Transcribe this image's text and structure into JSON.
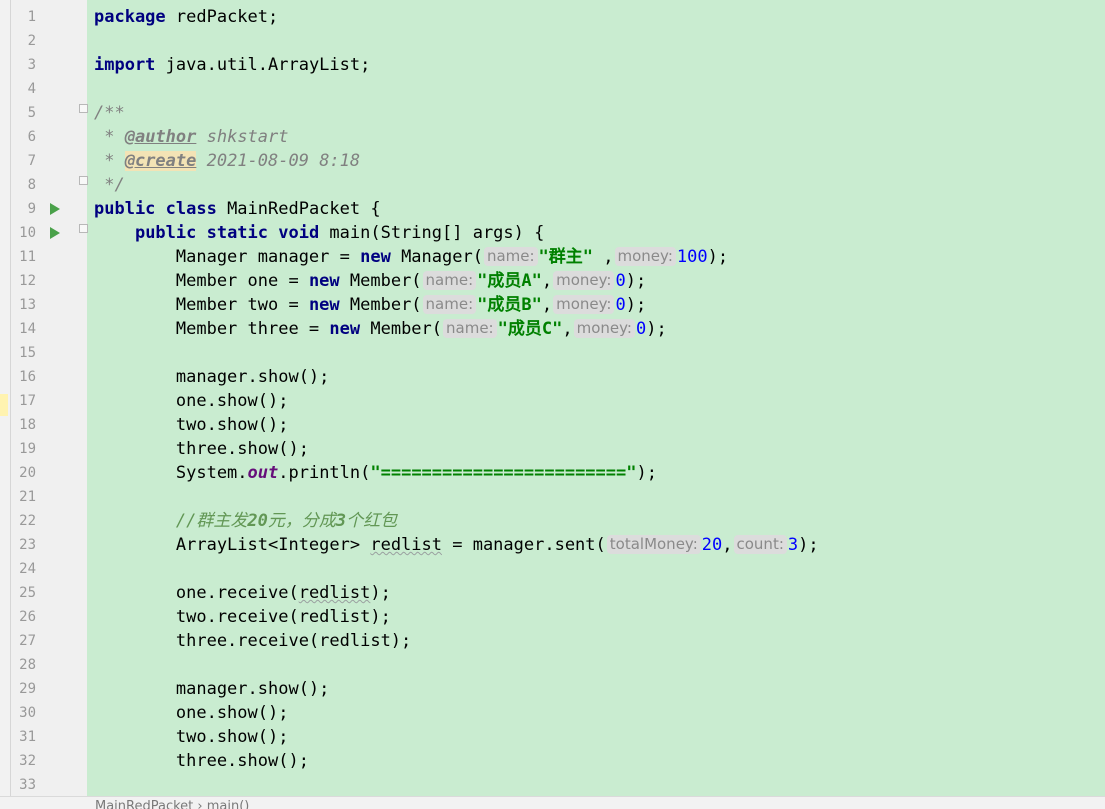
{
  "editor": {
    "file": "MainRedPacket.java",
    "lines": [
      {
        "n": "1",
        "html": "<span class=\"kw\">package</span> redPacket;"
      },
      {
        "n": "2",
        "html": ""
      },
      {
        "n": "3",
        "html": "<span class=\"kw\">import</span> java.util.ArrayList;"
      },
      {
        "n": "4",
        "html": ""
      },
      {
        "n": "5",
        "html": "<span class=\"cmt\">/**</span>"
      },
      {
        "n": "6",
        "html": "<span class=\"cmt\"> * </span><span class=\"tag\">@author</span><span class=\"cmt\"> shkstart</span>"
      },
      {
        "n": "7",
        "html": "<span class=\"cmt\"> * </span><span class=\"tag tag-hl\">@create</span><span class=\"cmt\"> 2021-08-09 8:18</span>"
      },
      {
        "n": "8",
        "html": "<span class=\"cmt\"> */</span>"
      },
      {
        "n": "9",
        "html": "<span class=\"kw\">public class</span> MainRedPacket {"
      },
      {
        "n": "10",
        "html": "    <span class=\"kw\">public static void</span> main(String[] args) {"
      },
      {
        "n": "11",
        "html": "        Manager manager = <span class=\"kw\">new</span> Manager(<span class=\"hint\">name:</span><span class=\"str\">\"群主\"</span> ,<span class=\"hint\">money:</span><span class=\"num\">100</span>);"
      },
      {
        "n": "12",
        "html": "        Member one = <span class=\"kw\">new</span> Member(<span class=\"hint\">name:</span><span class=\"str\">\"成员A\"</span>,<span class=\"hint\">money:</span><span class=\"num\">0</span>);"
      },
      {
        "n": "13",
        "html": "        Member two = <span class=\"kw\">new</span> Member(<span class=\"hint\">name:</span><span class=\"str\">\"成员B\"</span>,<span class=\"hint\">money:</span><span class=\"num\">0</span>);"
      },
      {
        "n": "14",
        "html": "        Member three = <span class=\"kw\">new</span> Member(<span class=\"hint\">name:</span><span class=\"str\">\"成员C\"</span>,<span class=\"hint\">money:</span><span class=\"num\">0</span>);"
      },
      {
        "n": "15",
        "html": ""
      },
      {
        "n": "16",
        "html": "        manager.show();"
      },
      {
        "n": "17",
        "html": "        one.show();"
      },
      {
        "n": "18",
        "html": "        two.show();"
      },
      {
        "n": "19",
        "html": "        three.show();"
      },
      {
        "n": "20",
        "html": "        System.<span class=\"field\">out</span>.println(<span class=\"str\">\"========================\"</span>);"
      },
      {
        "n": "21",
        "html": ""
      },
      {
        "n": "22",
        "html": "        <span class=\"lc\">//群主发</span><span class=\"lc-b\">20</span><span class=\"lc\">元，分成</span><span class=\"lc-b\">3</span><span class=\"lc\">个红包</span>"
      },
      {
        "n": "23",
        "html": "        ArrayList&lt;Integer&gt; <span class=\"squig\">redlist</span> = manager.sent(<span class=\"hint\">totalMoney:</span><span class=\"num\">20</span>,<span class=\"hint\">count:</span><span class=\"num\">3</span>);"
      },
      {
        "n": "24",
        "html": ""
      },
      {
        "n": "25",
        "html": "        one.receive(<span class=\"squig\">redlist</span>);"
      },
      {
        "n": "26",
        "html": "        two.receive(redlist);"
      },
      {
        "n": "27",
        "html": "        three.receive(redlist);"
      },
      {
        "n": "28",
        "html": ""
      },
      {
        "n": "29",
        "html": "        manager.show();"
      },
      {
        "n": "30",
        "html": "        one.show();"
      },
      {
        "n": "31",
        "html": "        two.show();"
      },
      {
        "n": "32",
        "html": "        three.show();"
      },
      {
        "n": "33",
        "html": ""
      }
    ],
    "run_markers": [
      "9",
      "10"
    ],
    "fold_markers": [
      "5",
      "8",
      "10"
    ]
  },
  "breadcrumb": "MainRedPacket › main()",
  "colors": {
    "background": "#c9ecd0",
    "keyword": "#000080",
    "string": "#008000",
    "number": "#0000ff",
    "comment": "#808080",
    "line_comment": "#629755",
    "static_field": "#660e7a"
  }
}
